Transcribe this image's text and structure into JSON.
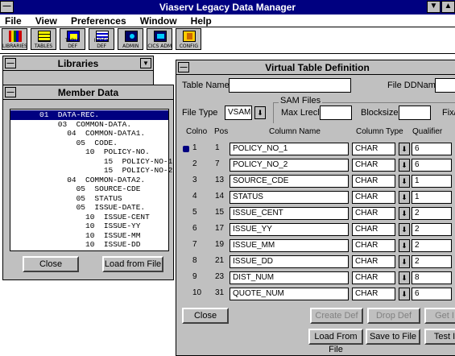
{
  "app": {
    "title": "Viaserv Legacy Data Manager",
    "min_glyph": "▼",
    "max_glyph": "▲",
    "sys_glyph": "—"
  },
  "menu": [
    "File",
    "View",
    "Preferences",
    "Window",
    "Help"
  ],
  "toolbar": [
    {
      "label": "LIBRARIES",
      "icon": "libraries-icon"
    },
    {
      "label": "TABLES",
      "icon": "tables-icon"
    },
    {
      "label": "TABLE DEF",
      "icon": "table-def-icon"
    },
    {
      "label": "INDEX DEF",
      "icon": "index-def-icon"
    },
    {
      "label": "ADMIN",
      "icon": "admin-icon"
    },
    {
      "label": "CICS ADM",
      "icon": "cics-adm-icon"
    },
    {
      "label": "CONFIG",
      "icon": "config-icon"
    }
  ],
  "libraries": {
    "title": "Libraries",
    "dd_glyph": "▼"
  },
  "member": {
    "title": "Member Data",
    "tree": [
      "01  DATA-REC.",
      "    03  COMMON-DATA.",
      "      04  COMMON-DATA1.",
      "        05  CODE.",
      "          10  POLICY-NO.",
      "              15  POLICY-NO-1",
      "              15  POLICY-NO-2",
      "      04  COMMON-DATA2.",
      "        05  SOURCE-CDE",
      "        05  STATUS",
      "        05  ISSUE-DATE.",
      "          10  ISSUE-CENT",
      "          10  ISSUE-YY",
      "          10  ISSUE-MM",
      "          10  ISSUE-DD"
    ],
    "close_label": "Close",
    "load_label": "Load from File"
  },
  "vtd": {
    "title": "Virtual Table Definition",
    "table_name_label": "Table Name",
    "table_name_value": "",
    "file_dd_label": "File DDName",
    "file_type_label": "File Type",
    "file_type_value": "VSAM",
    "sam_label": "SAM Files",
    "max_lrecl_label": "Max Lrecl",
    "blocksize_label": "Blocksize",
    "fix_label": "Fix/V",
    "headers": {
      "colno": "Colno",
      "pos": "Pos",
      "colname": "Column Name",
      "coltype": "Column Type",
      "qualifier": "Qualifier"
    },
    "rows": [
      {
        "colno": "1",
        "pos": "1",
        "name": "POLICY_NO_1",
        "type": "CHAR",
        "qual": "6",
        "marker": true
      },
      {
        "colno": "2",
        "pos": "7",
        "name": "POLICY_NO_2",
        "type": "CHAR",
        "qual": "6"
      },
      {
        "colno": "3",
        "pos": "13",
        "name": "SOURCE_CDE",
        "type": "CHAR",
        "qual": "1"
      },
      {
        "colno": "4",
        "pos": "14",
        "name": "STATUS",
        "type": "CHAR",
        "qual": "1"
      },
      {
        "colno": "5",
        "pos": "15",
        "name": "ISSUE_CENT",
        "type": "CHAR",
        "qual": "2"
      },
      {
        "colno": "6",
        "pos": "17",
        "name": "ISSUE_YY",
        "type": "CHAR",
        "qual": "2"
      },
      {
        "colno": "7",
        "pos": "19",
        "name": "ISSUE_MM",
        "type": "CHAR",
        "qual": "2"
      },
      {
        "colno": "8",
        "pos": "21",
        "name": "ISSUE_DD",
        "type": "CHAR",
        "qual": "2"
      },
      {
        "colno": "9",
        "pos": "23",
        "name": "DIST_NUM",
        "type": "CHAR",
        "qual": "8"
      },
      {
        "colno": "10",
        "pos": "31",
        "name": "QUOTE_NUM",
        "type": "CHAR",
        "qual": "6"
      }
    ],
    "buttons": {
      "close": "Close",
      "create_def": "Create Def",
      "drop_def": "Drop Def",
      "get": "Get I",
      "load_from_file": "Load From File",
      "save_to_file": "Save to File",
      "test": "Test I"
    }
  }
}
